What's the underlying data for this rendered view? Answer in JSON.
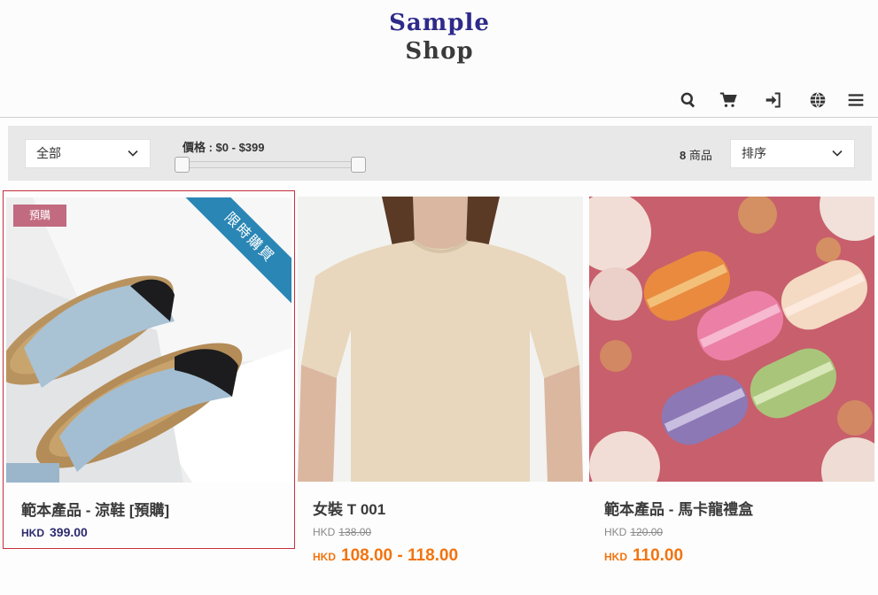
{
  "header": {
    "logo_line1": "Sample",
    "logo_line2": "Shop",
    "icons": [
      "search-icon",
      "cart-icon",
      "login-icon",
      "globe-icon",
      "menu-icon"
    ]
  },
  "filters": {
    "category": "全部",
    "price_label": "價格 : $0 - $399",
    "price_range": [
      0,
      399
    ],
    "count_number": "8",
    "count_unit": "商品",
    "sort_label": "排序"
  },
  "products": [
    {
      "title": "範本產品 - 涼鞋 [預購]",
      "currency": "HKD",
      "price": "399.00",
      "badge": "預購",
      "ribbon": "限時購買"
    },
    {
      "title": "女裝 T 001",
      "orig_currency": "HKD",
      "orig_price": "138.00",
      "currency": "HKD",
      "price": "108.00 - 118.00"
    },
    {
      "title": "範本產品 - 馬卡龍禮盒",
      "orig_currency": "HKD",
      "orig_price": "120.00",
      "currency": "HKD",
      "price": "110.00"
    }
  ],
  "colors": {
    "accent_orange": "#f2740f",
    "ribbon_blue": "#2a86b4",
    "badge_pink": "#c26a7f",
    "selected_border": "#c4303d"
  }
}
